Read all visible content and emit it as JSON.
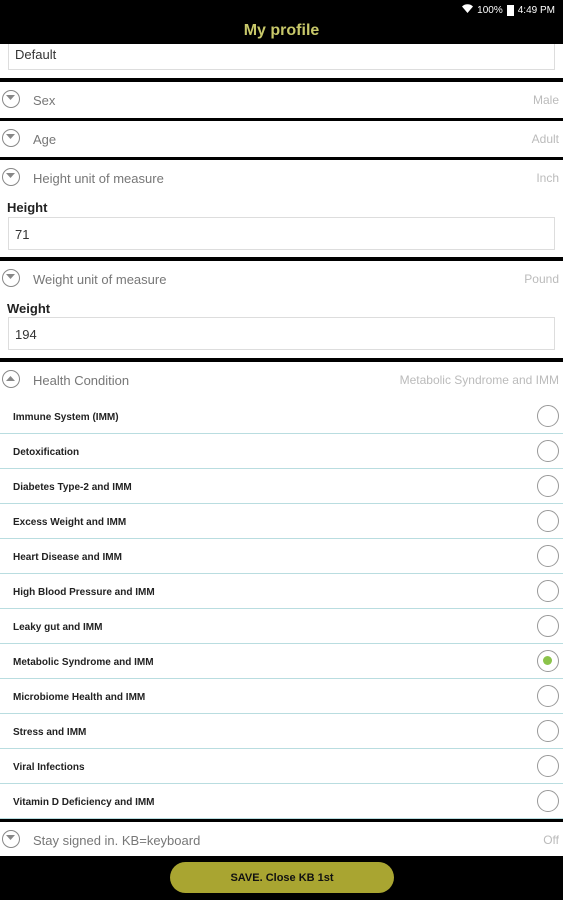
{
  "status": {
    "battery": "100%",
    "time": "4:49 PM"
  },
  "title": "My profile",
  "top_field": {
    "value": "Default"
  },
  "sex": {
    "label": "Sex",
    "value": "Male"
  },
  "age": {
    "label": "Age",
    "value": "Adult"
  },
  "height_unit": {
    "label": "Height unit of measure",
    "value": "Inch"
  },
  "height": {
    "label": "Height",
    "value": "71"
  },
  "weight_unit": {
    "label": "Weight unit of measure",
    "value": "Pound"
  },
  "weight": {
    "label": "Weight",
    "value": "194"
  },
  "health": {
    "label": "Health Condition",
    "value": "Metabolic Syndrome and IMM",
    "options": [
      {
        "label": "Immune System (IMM)",
        "checked": false
      },
      {
        "label": "Detoxification",
        "checked": false
      },
      {
        "label": "Diabetes Type-2 and IMM",
        "checked": false
      },
      {
        "label": "Excess Weight and IMM",
        "checked": false
      },
      {
        "label": "Heart Disease and IMM",
        "checked": false
      },
      {
        "label": "High Blood Pressure and IMM",
        "checked": false
      },
      {
        "label": "Leaky gut and IMM",
        "checked": false
      },
      {
        "label": "Metabolic Syndrome and IMM",
        "checked": true
      },
      {
        "label": "Microbiome Health and IMM",
        "checked": false
      },
      {
        "label": "Stress and IMM",
        "checked": false
      },
      {
        "label": "Viral Infections",
        "checked": false
      },
      {
        "label": "Vitamin D Deficiency and IMM",
        "checked": false
      }
    ]
  },
  "stay_signed": {
    "label": "Stay signed in. KB=keyboard",
    "value": "Off"
  },
  "save_label": "SAVE. Close KB 1st",
  "colors": {
    "accent": "#a9a531",
    "title": "#c8c86a",
    "radio_checked": "#8bc34a",
    "divider": "#b9dde0"
  }
}
